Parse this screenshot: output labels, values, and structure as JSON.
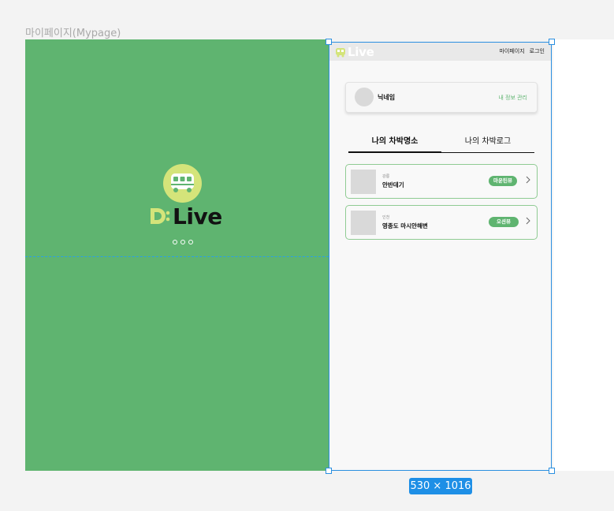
{
  "frame_label": "마이페이지(Mypage)",
  "splash": {
    "brand": "Live",
    "brand_prefix": "D"
  },
  "selection": {
    "size_label": "530 × 1016"
  },
  "mypage": {
    "topbar": {
      "brand": "Live",
      "links": [
        "마이페이지",
        "로그인"
      ]
    },
    "profile": {
      "nickname": "닉네임",
      "manage_label": "내 정보 관리"
    },
    "tabs": [
      {
        "label": "나의 차박명소",
        "active": true
      },
      {
        "label": "나의 차박로그",
        "active": false
      }
    ],
    "places": [
      {
        "region": "강릉",
        "name": "안반데기",
        "view": "마운틴뷰"
      },
      {
        "region": "인천",
        "name": "영종도 마시안해변",
        "view": "오션뷰"
      }
    ]
  },
  "colors": {
    "green": "#5fb470",
    "lime": "#d4e47a",
    "selection_blue": "#2a8fe0"
  }
}
